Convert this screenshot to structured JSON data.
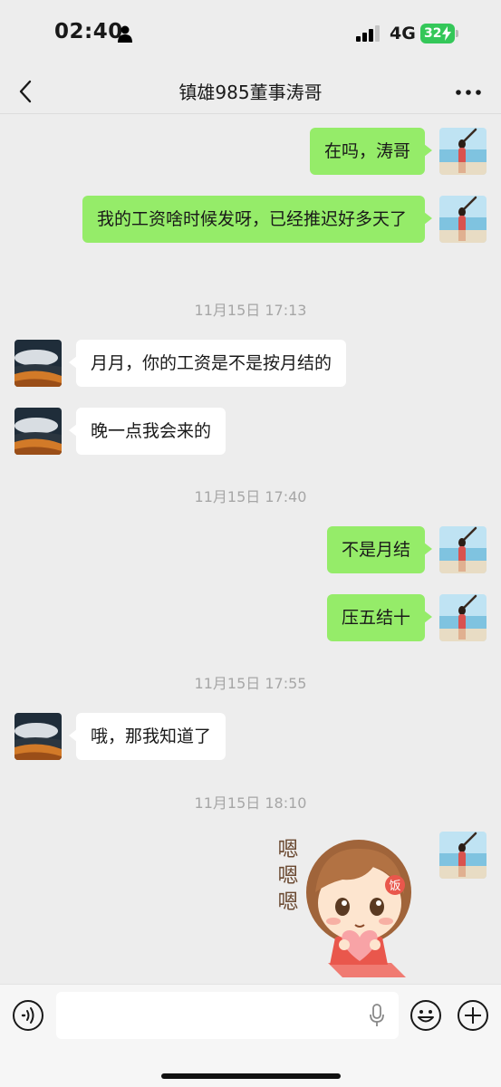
{
  "status_bar": {
    "time": "02:40",
    "network": "4G",
    "battery": "32"
  },
  "header": {
    "title": "镇雄985董事涛哥"
  },
  "messages": [
    {
      "from": "me",
      "text": "在吗，涛哥"
    },
    {
      "from": "me",
      "text": "我的工资啥时候发呀，已经推迟好多天了"
    },
    {
      "timestamp": "11月15日 17:13"
    },
    {
      "from": "them",
      "text": "月月，你的工资是不是按月结的"
    },
    {
      "from": "them",
      "text": "晚一点我会来的"
    },
    {
      "timestamp": "11月15日 17:40"
    },
    {
      "from": "me",
      "text": "不是月结"
    },
    {
      "from": "me",
      "text": "压五结十"
    },
    {
      "timestamp": "11月15日 17:55"
    },
    {
      "from": "them",
      "text": "哦，那我知道了"
    },
    {
      "timestamp": "11月15日 18:10"
    },
    {
      "from": "me",
      "sticker": "girl-holding-heart-sticker"
    }
  ],
  "sticker": {
    "text": "嗯嗯嗯",
    "badge": "饭"
  },
  "input_bar": {
    "value": ""
  },
  "colors": {
    "my_bubble": "#95ec69",
    "their_bubble": "#ffffff",
    "background": "#ededed",
    "battery": "#34c759"
  }
}
